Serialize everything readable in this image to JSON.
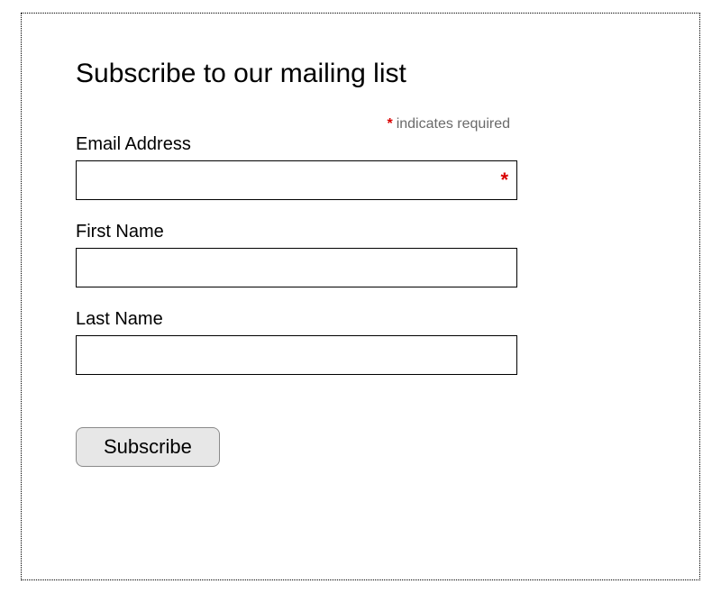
{
  "form": {
    "title": "Subscribe to our mailing list",
    "required_note_text": "indicates required",
    "required_asterisk": "*",
    "fields": {
      "email": {
        "label": "Email Address",
        "value": "",
        "required_marker": "*"
      },
      "first_name": {
        "label": "First Name",
        "value": ""
      },
      "last_name": {
        "label": "Last Name",
        "value": ""
      }
    },
    "submit_label": "Subscribe"
  }
}
